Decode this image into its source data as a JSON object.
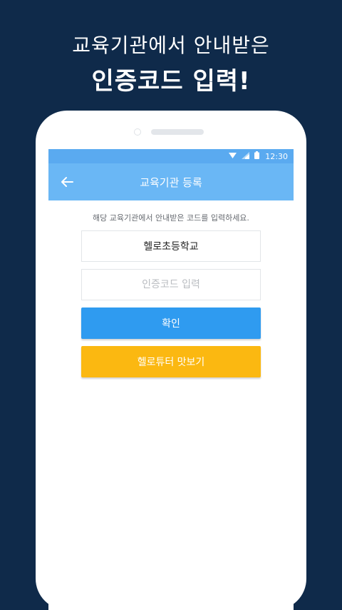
{
  "promo": {
    "line1": "교육기관에서 안내받은",
    "line2": "인증코드 입력!"
  },
  "statusbar": {
    "time": "12:30",
    "icons": [
      "wifi-icon",
      "signal-icon",
      "battery-icon"
    ]
  },
  "appbar": {
    "back_icon": "arrow-left-icon",
    "title": "교육기관 등록"
  },
  "form": {
    "instruction": "해당 교육기관에서 안내받은 코드를 입력하세요.",
    "school_name": "헬로초등학교",
    "code_placeholder": "인증코드 입력",
    "confirm_label": "확인",
    "preview_label": "헬로튜터 맛보기"
  },
  "colors": {
    "background": "#0f2a4a",
    "statusbar": "#5aaaf0",
    "appbar": "#6ab7f5",
    "confirm": "#2f9bf0",
    "preview": "#fbb811"
  }
}
